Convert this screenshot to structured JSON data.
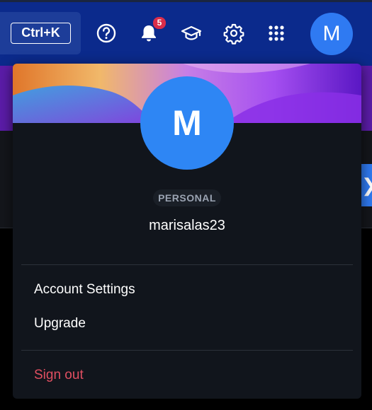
{
  "topbar": {
    "shortcut_label": "Ctrl+K",
    "icons": [
      "help-icon",
      "bell-icon",
      "graduation-cap-icon",
      "gear-icon",
      "apps-grid-icon"
    ],
    "notification_count": "5",
    "avatar_initial": "M"
  },
  "profile": {
    "avatar_initial": "M",
    "account_type": "PERSONAL",
    "username": "marisalas23"
  },
  "menu": {
    "account_settings": "Account Settings",
    "upgrade": "Upgrade",
    "sign_out": "Sign out"
  },
  "colors": {
    "topbar": "#0b2a8c",
    "avatar": "#2e86f4",
    "card": "#11151c",
    "sign_out": "#e04f61"
  }
}
